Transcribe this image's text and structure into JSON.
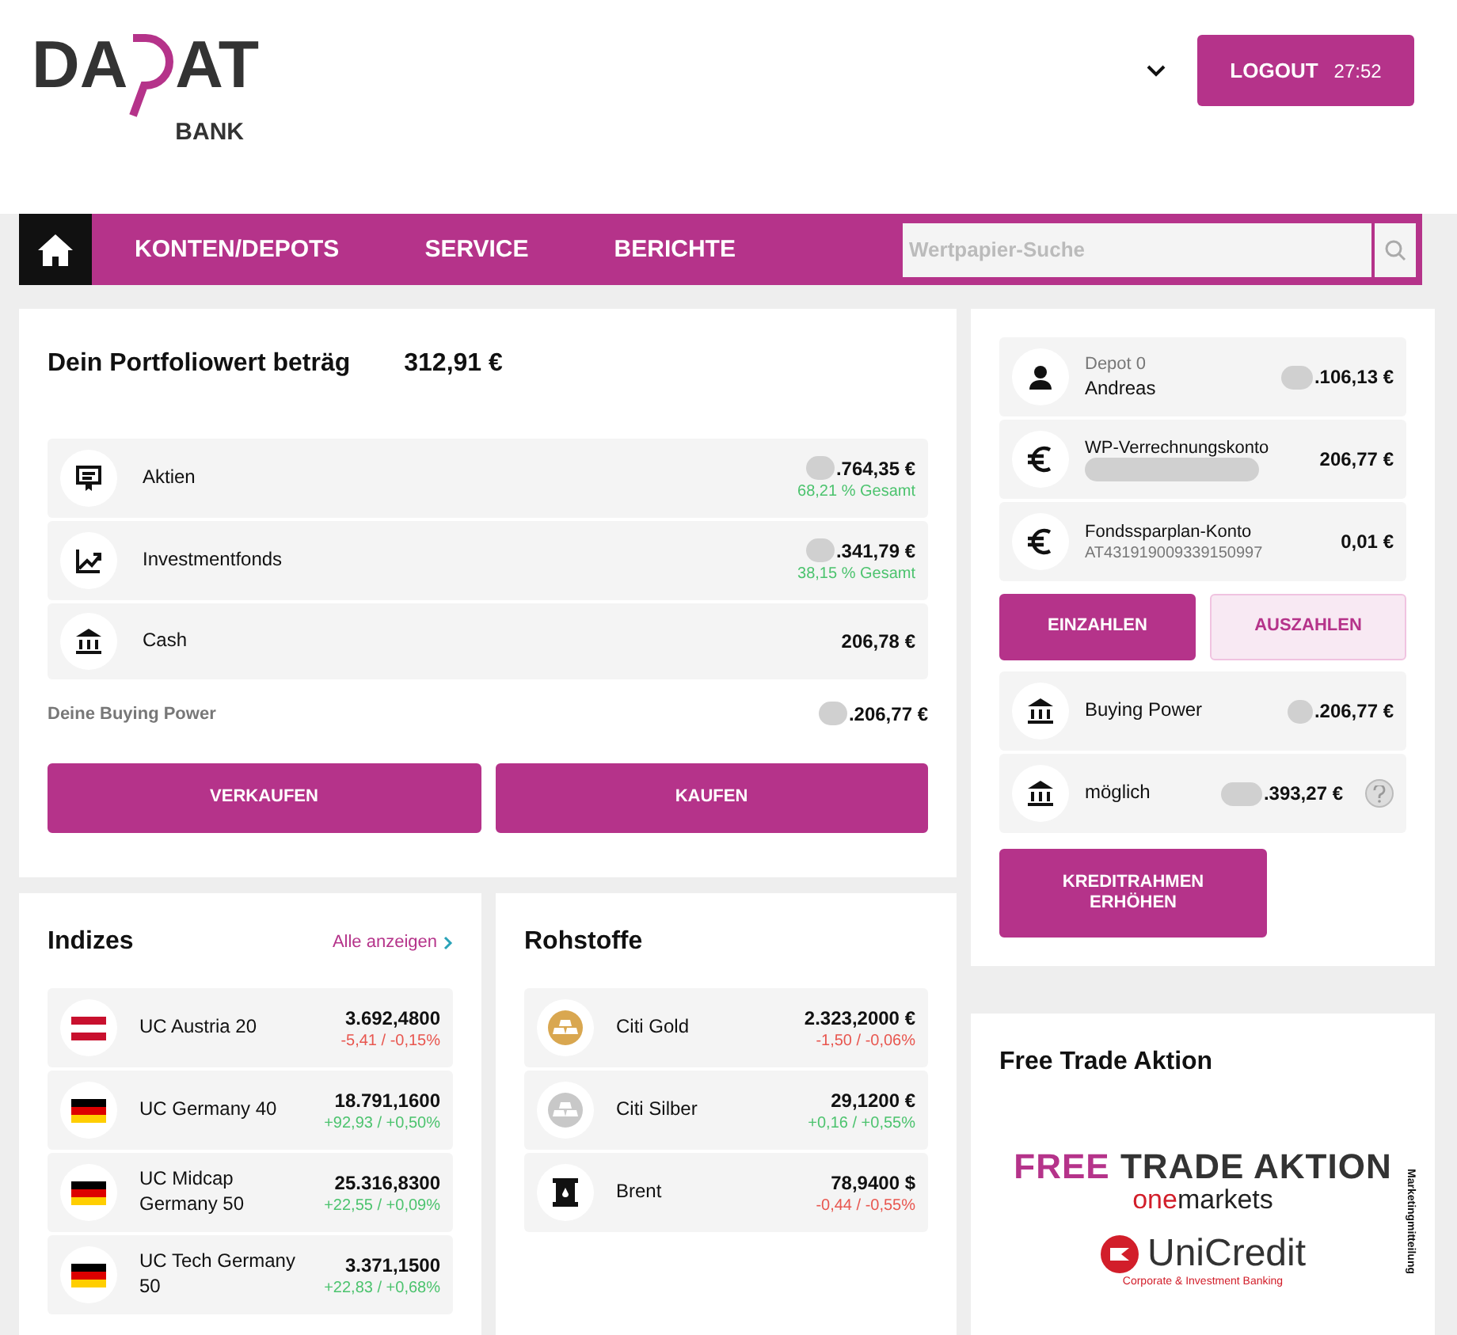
{
  "header": {
    "logo": {
      "left": "DA",
      "right": "AT",
      "sub": "BANK"
    },
    "logout": {
      "label": "LOGOUT",
      "timer": "27:52"
    }
  },
  "nav": {
    "items": [
      {
        "label": "KONTEN/DEPOTS"
      },
      {
        "label": "SERVICE"
      },
      {
        "label": "BERICHTE"
      }
    ],
    "search": {
      "placeholder": "Wertpapier-Suche"
    }
  },
  "portfolio": {
    "title": "Dein Portfoliowert beträg",
    "value": "312,91 €",
    "assets": [
      {
        "kind": "certificate",
        "label": "Aktien",
        "value": ".764,35 €",
        "share": "68,21 % Gesamt",
        "redacted": true
      },
      {
        "kind": "chart",
        "label": "Investmentfonds",
        "value": ".341,79 €",
        "share": "38,15 % Gesamt",
        "redacted": true
      },
      {
        "kind": "bank",
        "label": "Cash",
        "value": "206,78 €",
        "redacted": false
      }
    ],
    "buying_power": {
      "label": "Deine Buying Power",
      "value": ".206,77 €",
      "redacted": true
    },
    "buttons": [
      "VERKAUFEN",
      "KAUFEN"
    ]
  },
  "accounts": {
    "items": [
      {
        "kind": "person",
        "title": "Depot 0",
        "subtitle": "Andreas",
        "value": ".106,13 €",
        "redacted": true
      },
      {
        "kind": "euro",
        "title": "WP-Verrechnungskonto",
        "value": "206,77 €",
        "redacted": true
      },
      {
        "kind": "euro",
        "title": "Fondssparplan-Konto",
        "subtitle": "AT431919009339150997",
        "value": "0,01 €",
        "redacted": false
      }
    ],
    "actions": [
      {
        "label": "EINZAHLEN",
        "kind": "primary"
      },
      {
        "label": "AUSZAHLEN",
        "kind": "light"
      }
    ],
    "power": [
      {
        "label": "Buying Power",
        "value": ".206,77 €",
        "help": false,
        "redacted": true
      },
      {
        "label": "möglich",
        "value": ".393,27 €",
        "help": true,
        "redacted": true
      }
    ],
    "credit_button": "KREDITRAHMEN ERHÖHEN"
  },
  "indices": {
    "title": "Indizes",
    "link": "Alle anzeigen",
    "rows": [
      {
        "kind": "at",
        "name": "UC Austria 20",
        "price": "3.692,4800",
        "change": "-5,41 / -0,15%",
        "color": "#e8564f"
      },
      {
        "kind": "de",
        "name": "UC Germany 40",
        "price": "18.791,1600",
        "change": "+92,93 / +0,50%",
        "color": "#4cc36e"
      },
      {
        "kind": "de",
        "name": "UC Midcap Germany 50",
        "price": "25.316,8300",
        "change": "+22,55 / +0,09%",
        "color": "#4cc36e"
      },
      {
        "kind": "de",
        "name": "UC Tech Germany 50",
        "price": "3.371,1500",
        "change": "+22,83 / +0,68%",
        "color": "#4cc36e"
      }
    ]
  },
  "commodities": {
    "title": "Rohstoffe",
    "rows": [
      {
        "kind": "gold",
        "name": "Citi Gold",
        "price": "2.323,2000 €",
        "change": "-1,50 / -0,06%",
        "color": "#e8564f"
      },
      {
        "kind": "silver",
        "name": "Citi Silber",
        "price": "29,1200 €",
        "change": "+0,16 / +0,55%",
        "color": "#4cc36e"
      },
      {
        "kind": "oil",
        "name": "Brent",
        "price": "78,9400 $",
        "change": "-0,44 / -0,55%",
        "color": "#e8564f"
      }
    ]
  },
  "promo": {
    "title": "Free Trade Aktion",
    "banner": {
      "headline_accent": "FREE",
      "headline": "TRADE AKTION",
      "brand_accent": "one",
      "brand": "markets",
      "bank": "UniCredit",
      "bank_sub": "Corporate & Investment Banking",
      "side_note": "Marketingmitteilung"
    }
  }
}
